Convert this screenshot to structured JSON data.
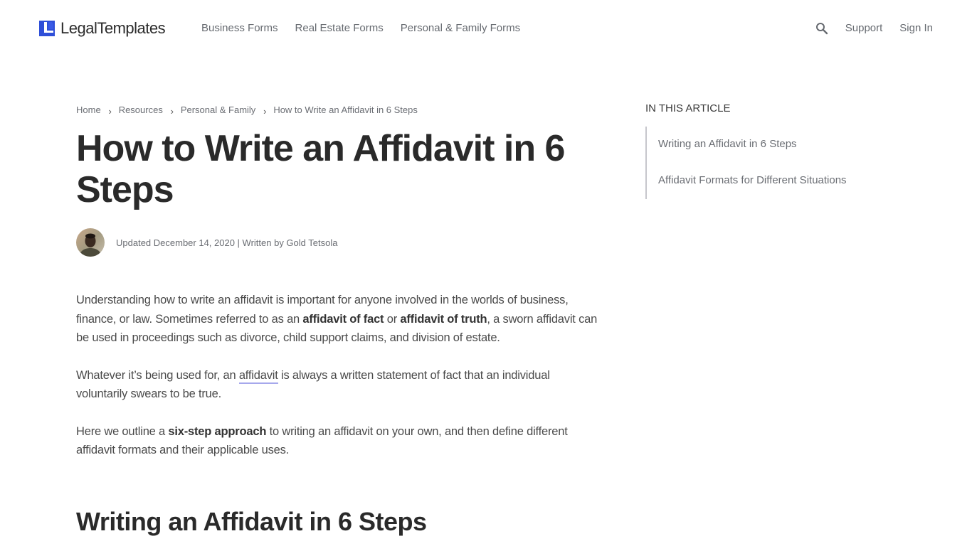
{
  "header": {
    "logo_text": "LegalTemplates",
    "brand_color": "#2f4fd8",
    "nav": [
      {
        "label": "Business Forms"
      },
      {
        "label": "Real Estate Forms"
      },
      {
        "label": "Personal & Family Forms"
      }
    ],
    "search_icon": "search-icon",
    "support_label": "Support",
    "signin_label": "Sign In"
  },
  "breadcrumb": {
    "items": [
      {
        "label": "Home"
      },
      {
        "label": "Resources"
      },
      {
        "label": "Personal & Family"
      }
    ],
    "separator": "›",
    "current": "How to Write an Affidavit in 6 Steps"
  },
  "article": {
    "title": "How to Write an Affidavit in 6 Steps",
    "byline": "Updated December 14, 2020 | Written by Gold Tetsola",
    "paragraphs": {
      "p1": {
        "t1": "Understanding how to write an affidavit is important for anyone involved in the worlds of business, finance, or law. Sometimes referred to as an ",
        "b1": "affidavit of fact",
        "t2": " or ",
        "b2": "affidavit of truth",
        "t3": ", a sworn affidavit can be used in proceedings such as divorce, child support claims, and division of estate."
      },
      "p2": {
        "t1": "Whatever it’s being used for, an ",
        "link": "affidavit",
        "t2": " is always a written statement of fact that an individual voluntarily swears to be true."
      },
      "p3": {
        "t1": "Here we outline a ",
        "b1": "six-step approach",
        "t2": " to writing an affidavit on your own, and then define different affidavit formats and their applicable uses."
      }
    },
    "section_title": "Writing an Affidavit in 6 Steps"
  },
  "toc": {
    "heading": "IN THIS ARTICLE",
    "items": [
      {
        "label": "Writing an Affidavit in 6 Steps"
      },
      {
        "label": "Affidavit Formats for Different Situations"
      }
    ]
  }
}
